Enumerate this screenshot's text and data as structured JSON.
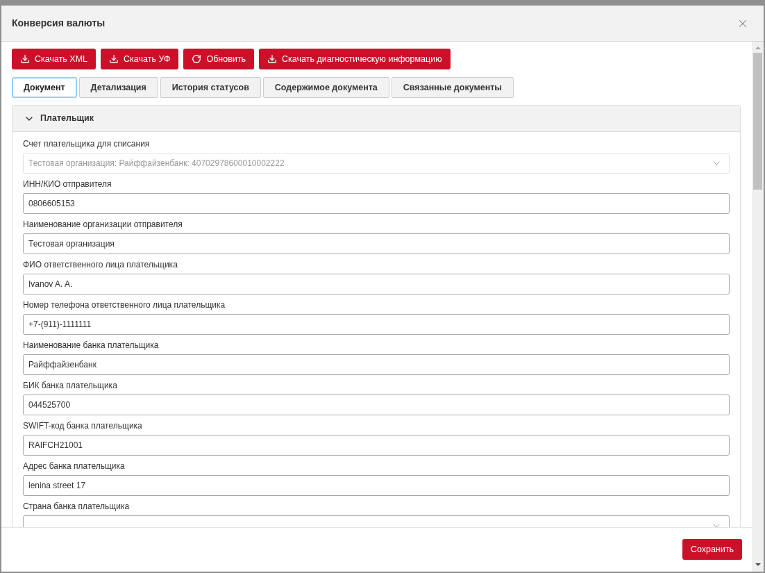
{
  "dialog": {
    "title": "Конверсия валюты"
  },
  "toolbar": [
    {
      "label": "Скачать XML",
      "kind": "download"
    },
    {
      "label": "Скачать УФ",
      "kind": "download"
    },
    {
      "label": "Обновить",
      "kind": "refresh"
    },
    {
      "label": "Скачать диагностическую информацию",
      "kind": "download"
    }
  ],
  "tabs": [
    {
      "label": "Документ",
      "selected": true
    },
    {
      "label": "Детализация",
      "selected": false
    },
    {
      "label": "История статусов",
      "selected": false
    },
    {
      "label": "Содержимое документа",
      "selected": false
    },
    {
      "label": "Связанные документы",
      "selected": false
    }
  ],
  "section": {
    "title": "Плательщик",
    "expanded": true,
    "fields": [
      {
        "label": "Счет плательщика для списания",
        "kind": "select",
        "value": "Тестовая организация: Райффайзенбанк: 40702978600010002222",
        "disabled": true
      },
      {
        "label": "ИНН/КИО отправителя",
        "kind": "text",
        "value": "0806605153",
        "disabled": false
      },
      {
        "label": "Наименование организации отправителя",
        "kind": "text",
        "value": "Тестовая организация",
        "disabled": false
      },
      {
        "label": "ФИО ответственного лица плательщика",
        "kind": "text",
        "value": "Ivanov A. A.",
        "disabled": false
      },
      {
        "label": "Номер телефона ответственного лица плательщика",
        "kind": "text",
        "value": "+7-(911)-1111111",
        "disabled": false
      },
      {
        "label": "Наименование банка плательщика",
        "kind": "text",
        "value": "Райффайзенбанк",
        "disabled": false
      },
      {
        "label": "БИК банка плательщика",
        "kind": "text",
        "value": "044525700",
        "disabled": false
      },
      {
        "label": "SWIFT-код банка плательщика",
        "kind": "text",
        "value": "RAIFCH21001",
        "disabled": false
      },
      {
        "label": "Адрес банка плательщика",
        "kind": "text",
        "value": "lenina street 17",
        "disabled": false
      },
      {
        "label": "Страна банка плательщика",
        "kind": "select",
        "disabled": false
      }
    ]
  },
  "footer": {
    "save_button": "Сохранить"
  }
}
